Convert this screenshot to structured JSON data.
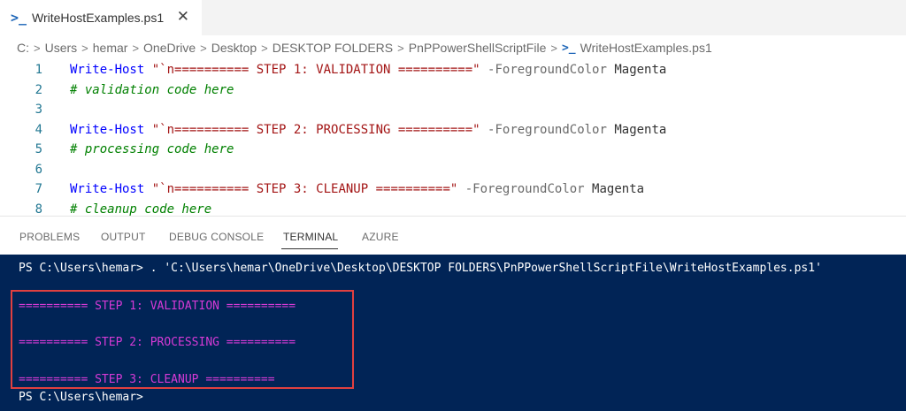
{
  "tab": {
    "title": "WriteHostExamples.ps1",
    "close": "✕"
  },
  "breadcrumb": [
    "C:",
    "Users",
    "hemar",
    "OneDrive",
    "Desktop",
    "DESKTOP FOLDERS",
    "PnPPowerShellScriptFile",
    "WriteHostExamples.ps1"
  ],
  "editor": {
    "lines": [
      {
        "num": "1",
        "cmd": "Write-Host",
        "str": "\"`n========== STEP 1: VALIDATION ==========\"",
        "param": "-ForegroundColor",
        "val": "Magenta"
      },
      {
        "num": "2",
        "comment": "# validation code here"
      },
      {
        "num": "3"
      },
      {
        "num": "4",
        "cmd": "Write-Host",
        "str": "\"`n========== STEP 2: PROCESSING ==========\"",
        "param": "-ForegroundColor",
        "val": "Magenta"
      },
      {
        "num": "5",
        "comment": "# processing code here"
      },
      {
        "num": "6"
      },
      {
        "num": "7",
        "cmd": "Write-Host",
        "str": "\"`n========== STEP 3: CLEANUP ==========\"",
        "param": "-ForegroundColor",
        "val": "Magenta"
      },
      {
        "num": "8",
        "comment": "# cleanup code here"
      }
    ]
  },
  "panel": {
    "tabs": [
      "PROBLEMS",
      "OUTPUT",
      "DEBUG CONSOLE",
      "TERMINAL",
      "AZURE"
    ],
    "active": "TERMINAL"
  },
  "terminal": {
    "command_line": "PS C:\\Users\\hemar> . 'C:\\Users\\hemar\\OneDrive\\Desktop\\DESKTOP FOLDERS\\PnPPowerShellScriptFile\\WriteHostExamples.ps1'",
    "output": [
      "========== STEP 1: VALIDATION ==========",
      "========== STEP 2: PROCESSING ==========",
      "========== STEP 3: CLEANUP =========="
    ],
    "prompt": "PS C:\\Users\\hemar>"
  },
  "colors": {
    "terminal_bg": "#012456",
    "output_magenta": "#d63ad6",
    "highlight_border": "#e04040",
    "powershell_blue": "#1e66b8"
  },
  "icons": {
    "tab_icon": "powershell-icon",
    "close_icon": "close-icon",
    "breadcrumb_sep": "chevron-right-icon"
  }
}
